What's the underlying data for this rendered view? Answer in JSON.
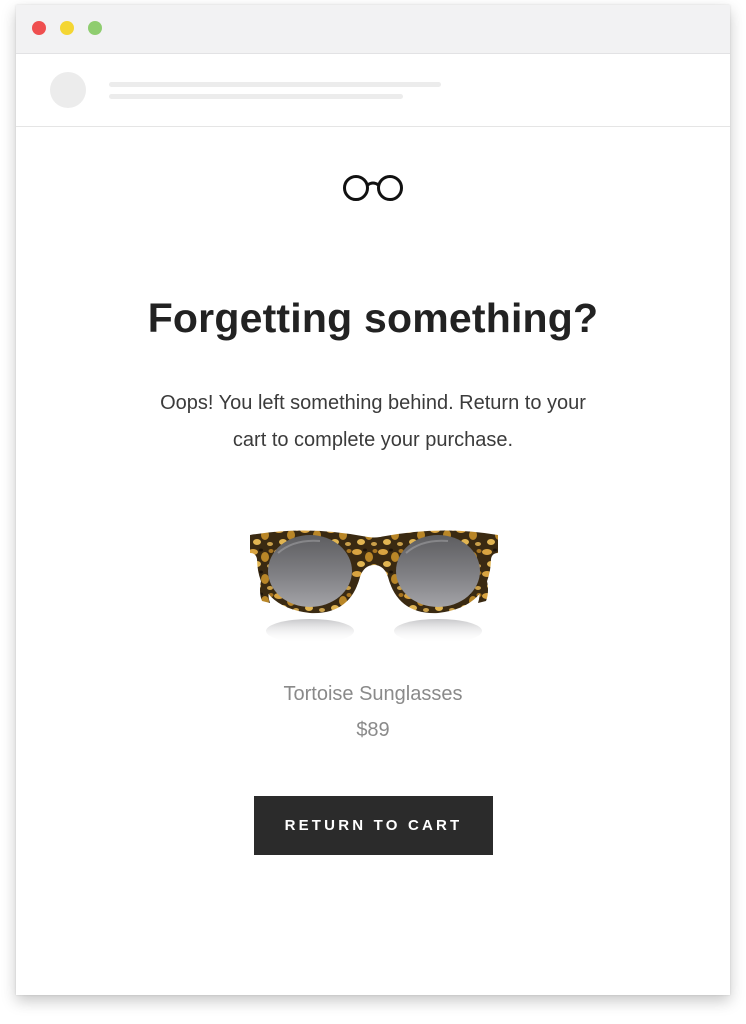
{
  "window": {
    "controls": [
      "close",
      "minimize",
      "zoom"
    ],
    "colors": {
      "close": "#ef4f4f",
      "minimize": "#f4d633",
      "zoom": "#8fcd6f"
    }
  },
  "email": {
    "logo_icon": "glasses-icon",
    "headline": "Forgetting something?",
    "body": "Oops! You left something behind. Return to your cart to complete your purchase.",
    "product": {
      "image_icon": "tortoise-sunglasses-image",
      "name": "Tortoise Sunglasses",
      "price": "$89"
    },
    "cta_label": "RETURN TO CART",
    "cta_color": "#2b2b2b"
  }
}
